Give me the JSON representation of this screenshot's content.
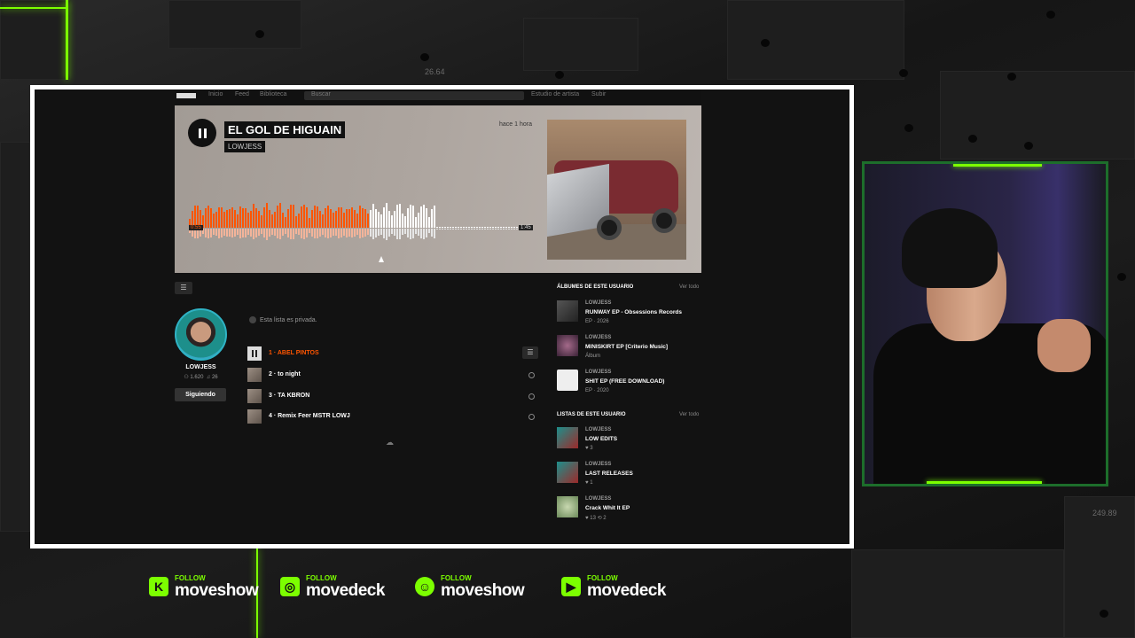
{
  "nav": {
    "items": [
      "Inicio",
      "Feed",
      "Biblioteca"
    ],
    "search_placeholder": "Buscar",
    "right_link": "Estudio de artista",
    "right_link2": "Subir"
  },
  "track": {
    "title": "EL GOL DE HIGUAIN",
    "artist": "LOWJESS",
    "posted": "hace 1 hora",
    "time_current": "0:55",
    "time_total": "1:45",
    "progress": 0.53
  },
  "profile": {
    "name": "LOWJESS",
    "followers": "1.620",
    "tracks": "26",
    "follow_label": "Siguiendo"
  },
  "playlist": {
    "private_note": "Esta lista es privada.",
    "tracks": [
      {
        "label": "1 · ABEL PINTOS",
        "active": true
      },
      {
        "label": "2 · to night",
        "active": false
      },
      {
        "label": "3 · TA KBRON",
        "active": false
      },
      {
        "label": "4 · Remix Feer MSTR LOWJ",
        "active": false
      }
    ]
  },
  "albums": {
    "title": "ÁLBUMES DE ESTE USUARIO",
    "see_all": "Ver todo",
    "items": [
      {
        "user": "LOWJESS",
        "title": "RUNWAY EP - Obsessions Records",
        "meta": "EP · 2026"
      },
      {
        "user": "LOWJESS",
        "title": "MINISKIRT EP [Criterio Music]",
        "meta": "Álbum"
      },
      {
        "user": "LOWJESS",
        "title": "SHIT EP (FREE DOWNLOAD)",
        "meta": "EP · 2020"
      }
    ]
  },
  "lists": {
    "title": "LISTAS DE ESTE USUARIO",
    "see_all": "Ver todo",
    "items": [
      {
        "user": "LOWJESS",
        "title": "LOW EDITS",
        "meta": "♥ 3"
      },
      {
        "user": "LOWJESS",
        "title": "LAST RELEASES",
        "meta": "♥ 1"
      },
      {
        "user": "LOWJESS",
        "title": "Crack Whit It EP",
        "meta": "♥ 13  ⟲ 2"
      }
    ]
  },
  "overlay": {
    "numbers": [
      "26.64",
      "249.89"
    ],
    "socials": [
      {
        "icon": "kick-icon",
        "glyph": "K",
        "follow": "FOLLOW",
        "handle": "moveshow"
      },
      {
        "icon": "instagram-icon",
        "glyph": "◎",
        "follow": "FOLLOW",
        "handle": "movedeck"
      },
      {
        "icon": "discord-icon",
        "glyph": "☺",
        "follow": "FOLLOW",
        "handle": "moveshow"
      },
      {
        "icon": "youtube-icon",
        "glyph": "▶",
        "follow": "FOLLOW",
        "handle": "movedeck"
      }
    ]
  },
  "colors": {
    "accent": "#ff5500",
    "neon": "#7cff00"
  }
}
